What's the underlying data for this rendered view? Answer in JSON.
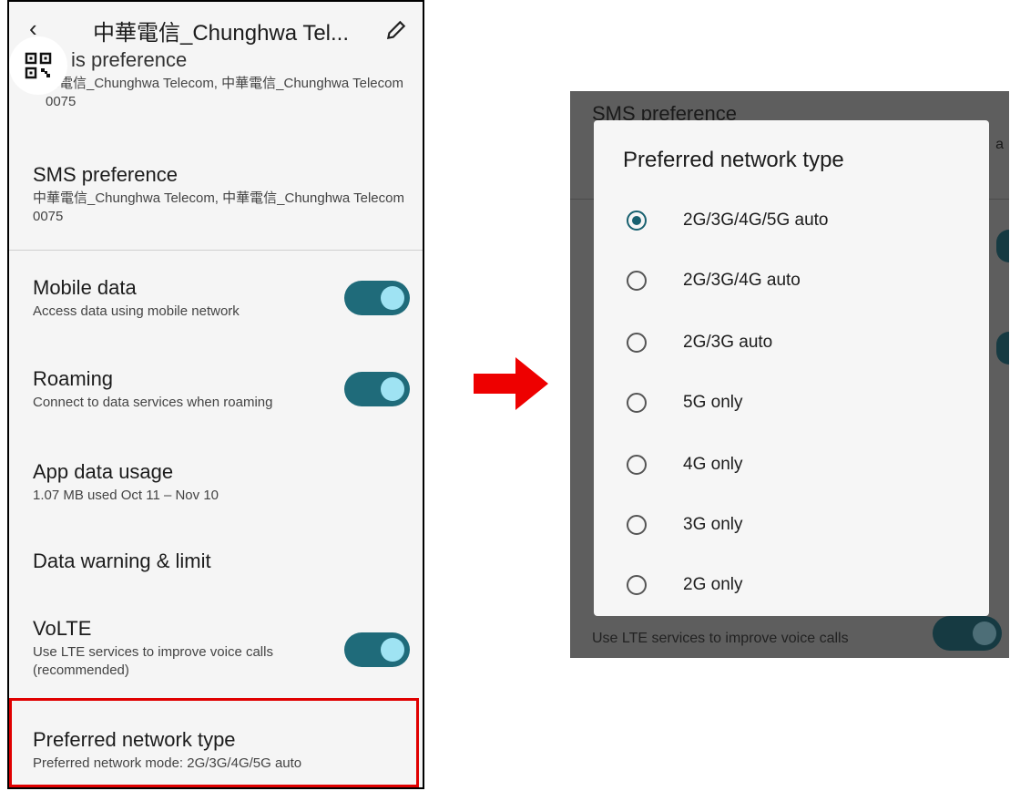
{
  "left_screen": {
    "topbar": {
      "title": "中華電信_Chunghwa Tel..."
    },
    "calls_preference": {
      "title_visible": "is preference",
      "subtitle": "華電信_Chunghwa Telecom, 中華電信_Chunghwa Telecom 0075"
    },
    "sms_preference": {
      "title": "SMS preference",
      "subtitle": "中華電信_Chunghwa Telecom, 中華電信_Chunghwa Telecom 0075"
    },
    "mobile_data": {
      "title": "Mobile data",
      "subtitle": "Access data using mobile network",
      "enabled": true
    },
    "roaming": {
      "title": "Roaming",
      "subtitle": "Connect to data services when roaming",
      "enabled": true
    },
    "app_data_usage": {
      "title": "App data usage",
      "subtitle": "1.07 MB used Oct 11 – Nov 10"
    },
    "data_warning": {
      "title": "Data warning & limit"
    },
    "volte": {
      "title": "VoLTE",
      "subtitle": "Use LTE services to improve voice calls (recommended)",
      "enabled": true
    },
    "preferred_network": {
      "title": "Preferred network type",
      "subtitle": "Preferred network mode: 2G/3G/4G/5G auto"
    },
    "icons": {
      "back": "back-arrow-icon",
      "edit": "pencil-icon",
      "qr": "qr-code-icon"
    }
  },
  "right_screen": {
    "background": {
      "sms_title": "SMS preference",
      "edge_letter": "a",
      "volte_subtitle": "Use LTE services to improve voice calls"
    },
    "dialog": {
      "title": "Preferred network type",
      "selected_index": 0,
      "options": [
        "2G/3G/4G/5G auto",
        "2G/3G/4G auto",
        "2G/3G auto",
        "5G only",
        "4G only",
        "3G only",
        "2G only"
      ]
    }
  },
  "colors": {
    "toggle_track": "#1f6b7a",
    "toggle_knob": "#9fe3f3",
    "radio_selected": "#17606f",
    "highlight": "#e00000",
    "arrow": "#ee0000"
  }
}
